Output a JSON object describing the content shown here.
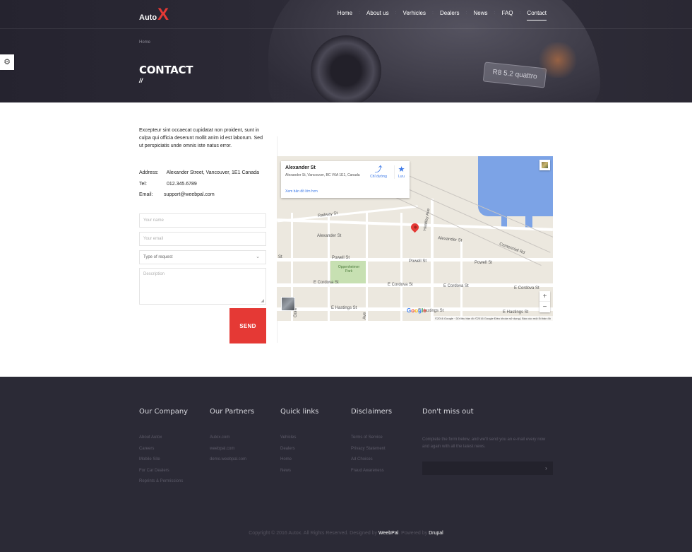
{
  "brand": {
    "logo_text": "Auto",
    "logo_mark": "X",
    "accent_color": "#e53935"
  },
  "nav": {
    "items": [
      {
        "label": "Home"
      },
      {
        "label": "About us"
      },
      {
        "label": "Verhicles"
      },
      {
        "label": "Dealers"
      },
      {
        "label": "News"
      },
      {
        "label": "FAQ"
      },
      {
        "label": "Contact",
        "active": true
      }
    ]
  },
  "hero": {
    "breadcrumb": "Home",
    "title": "CONTACT",
    "title_mark": "//",
    "plate_text": "R8 5.2 quattro"
  },
  "contact": {
    "intro": "Excepteur sint occaecat cupidatat non proident, sunt in culpa qui officia deserunt mollit anim id est laborum. Sed ut perspiciatis unde omnis iste natus error.",
    "address_label": "Address:",
    "address_value": "Alexander Street, Vancouver, 1E1 Canada",
    "tel_label": "Tel:",
    "tel_value": "012.345.6789",
    "email_label": "Email:",
    "email_value": "support@weebpal.com"
  },
  "form": {
    "name_placeholder": "Your name",
    "email_placeholder": "Your email",
    "request_type": "Type of request",
    "description_placeholder": "Description",
    "send_label": "SEND"
  },
  "map": {
    "place_name": "Alexander St",
    "place_address": "Alexander St, Vancouver, BC V6A 1E1, Canada",
    "directions_label": "Chỉ đường",
    "save_label": "Lưu",
    "bigger_map_label": "Xem bản đồ lớn hơn",
    "streets": {
      "railway": "Railway St",
      "alexander_left": "Alexander St",
      "alexander_right": "Alexander St",
      "heatley": "Heatley Ave",
      "centennial": "Centennial Rd",
      "powell_left": "Powell St",
      "powell_mid": "Powell St",
      "powell_right": "Powell St",
      "cordova_left": "E Cordova St",
      "cordova_mid": "E Cordova St",
      "cordova_mid2": "E Cordova St",
      "cordova_right": "E Cordova St",
      "hastings_left": "E Hastings St",
      "hastings_mid": "E Hastings St",
      "hastings_right": "E Hastings St",
      "st_left": "St",
      "gore": "Gore",
      "ave": "Ave"
    },
    "park_label": "Oppenheimer Park",
    "zoom_in": "+",
    "zoom_out": "−",
    "attribution": "©2016 Google · Dữ liệu bản đồ ©2016 Google   Điều khoản sử dụng | Báo cáo một lỗi bản đồ"
  },
  "footer": {
    "columns": [
      {
        "heading": "Our Company",
        "links": [
          "About Autox",
          "Careers",
          "Mobile Site",
          "For Car Dealers",
          "Reprints & Permissions"
        ]
      },
      {
        "heading": "Our Partners",
        "links": [
          "Autox.com",
          "weebpal.com",
          "demo.weebpal.com"
        ]
      },
      {
        "heading": "Quick links",
        "links": [
          "Vehicles",
          "Dealers",
          "Home",
          "News"
        ]
      },
      {
        "heading": "Disclaimers",
        "links": [
          "Terms of Service",
          "Privacy Statement",
          "Ad Choices",
          "Fraud Awareness"
        ]
      },
      {
        "heading": "Don't miss out"
      }
    ],
    "newsletter_text": "Complete the form below, and we'll send you an e-mail every now and again with all the latest news.",
    "newsletter_submit": "›",
    "copyright_prefix": "Copyright © 2016 Autox. All Rights Reserved. Designed by",
    "designer": "WeebPal",
    "powered_prefix": ". Powered by",
    "platform": "Drupal"
  },
  "icons": {
    "settings": "gear-icon",
    "directions": "directions-icon",
    "save": "star-icon",
    "map_pin": "map-pin-icon",
    "chevron": "chevron-down-icon"
  }
}
